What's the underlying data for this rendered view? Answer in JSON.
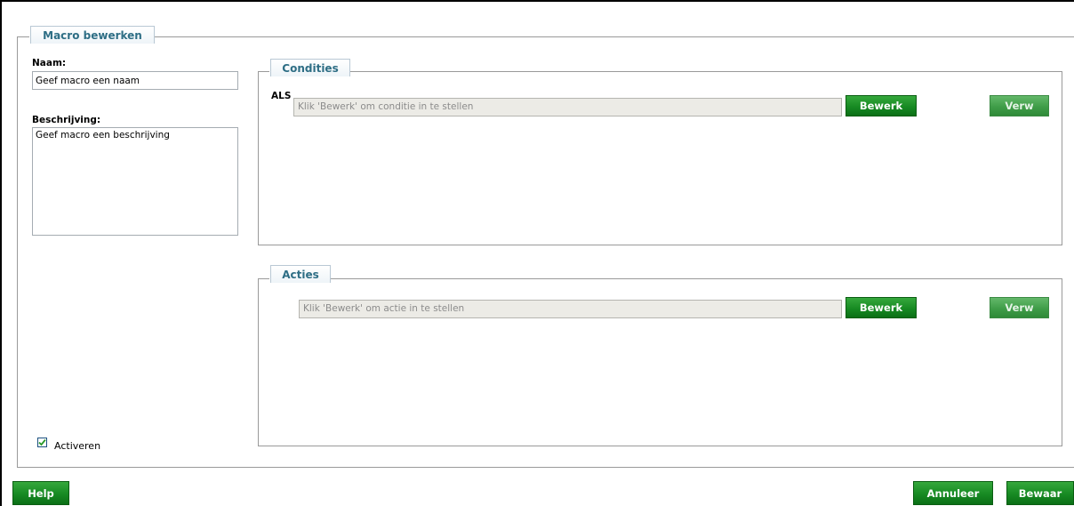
{
  "macro": {
    "title": "Macro bewerken",
    "name_label": "Naam:",
    "name_value": "Geef macro een naam",
    "description_label": "Beschrijving:",
    "description_value": "Geef macro een beschrijving",
    "activate_label": "Activeren",
    "activate_checked": true
  },
  "conditions": {
    "title": "Condities",
    "if_label": "ALS",
    "field_text": "Klik 'Bewerk' om conditie in te stellen",
    "edit_label": "Bewerk",
    "remove_label": "Verw"
  },
  "actions": {
    "title": "Acties",
    "field_text": "Klik 'Bewerk' om actie in te stellen",
    "edit_label": "Bewerk",
    "remove_label": "Verw"
  },
  "footer": {
    "help_label": "Help",
    "cancel_label": "Annuleer",
    "save_label": "Bewaar"
  },
  "colors": {
    "button_green": "#178a23",
    "legend_text": "#2e6e85"
  }
}
